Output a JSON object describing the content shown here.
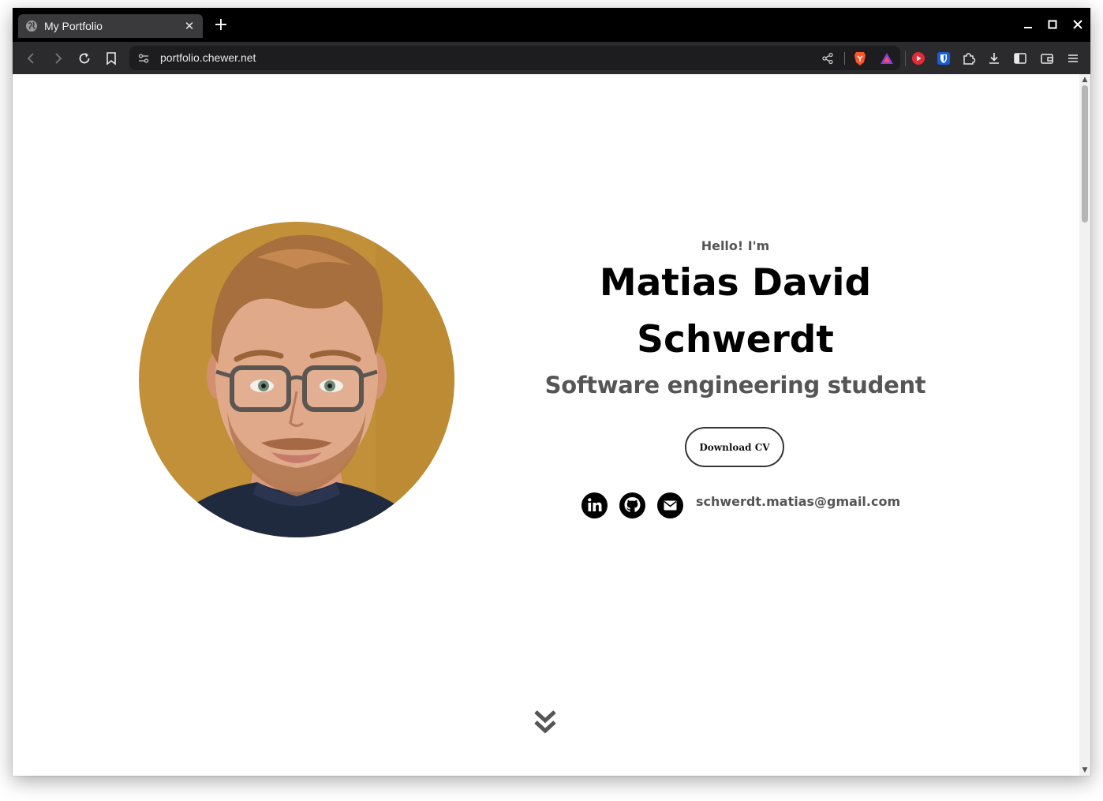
{
  "browser": {
    "tab": {
      "title": "My Portfolio",
      "favicon": "globe-icon"
    },
    "url": "portfolio.chewer.net",
    "accent": "#000000"
  },
  "hero": {
    "greeting": "Hello! I'm",
    "name_line1": "Matias David",
    "name_line2": "Schwerdt",
    "subtitle": "Software engineering student",
    "cv_button": "Download CV",
    "email": "schwerdt.matias@gmail.com",
    "socials": [
      "linkedin-icon",
      "github-icon",
      "mail-icon"
    ],
    "photo_background": "#c19038"
  }
}
